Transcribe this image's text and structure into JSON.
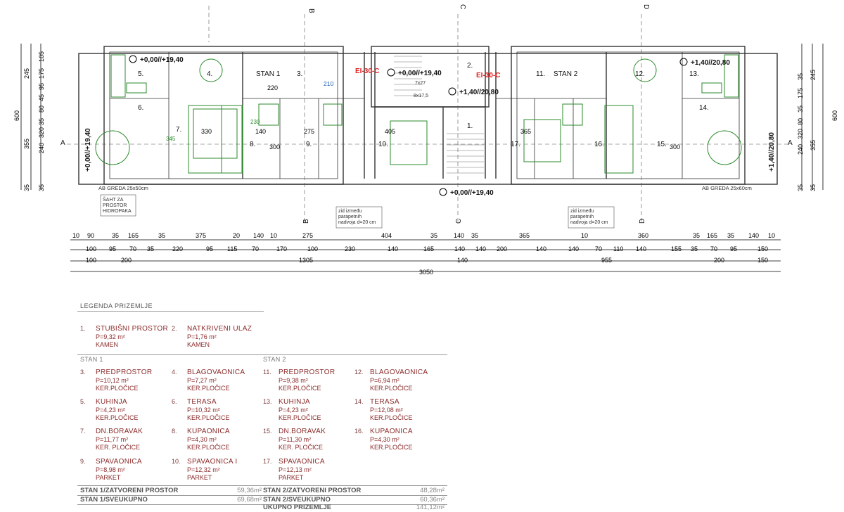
{
  "plan": {
    "dims_top_row1": [
      "10",
      "90",
      "35",
      "165",
      "35",
      "375",
      "20",
      "140",
      "10",
      "275",
      "404",
      "35",
      "140",
      "35",
      "365",
      "10",
      "360",
      "35",
      "165",
      "35",
      "140",
      "10"
    ],
    "dims_top_row2": [
      "100",
      "95",
      "70",
      "35",
      "220",
      "95",
      "115",
      "70",
      "170",
      "100",
      "230",
      "140",
      "165",
      "140",
      "140",
      "200",
      "140",
      "140",
      "70",
      "110",
      "140",
      "155",
      "35",
      "70",
      "95",
      "150"
    ],
    "dims_top_row3": [
      "100",
      "200",
      "1305",
      "140",
      "955",
      "200",
      "150"
    ],
    "dims_total": "3050",
    "dims_left": [
      "245",
      "105",
      "175",
      "95",
      "45",
      "80",
      "35",
      "355",
      "320",
      "240",
      "35",
      "35"
    ],
    "dims_left_total": "600",
    "dims_right": [
      "35",
      "175",
      "245",
      "35",
      "80",
      "320",
      "355",
      "240",
      "35",
      "35"
    ],
    "dims_right_total": "600",
    "section_marks": [
      "A",
      "A",
      "B",
      "B",
      "C",
      "C",
      "D",
      "D",
      "E"
    ],
    "elevations": [
      "+0,00//+19,40",
      "+0,00//+19,40",
      "+1,40//20,80",
      "+1,40//20,80",
      "+0,00//+19,40",
      "+0,00//+19,40",
      "+1,40//20,80"
    ],
    "room_numbers": [
      "1.",
      "2.",
      "3.",
      "4.",
      "5.",
      "6.",
      "7.",
      "8.",
      "9.",
      "10.",
      "11.",
      "12.",
      "13.",
      "14.",
      "15.",
      "16.",
      "17."
    ],
    "unit_labels": [
      "STAN 1",
      "STAN 2"
    ],
    "red_labels": [
      "EI-30-C",
      "EI-30-C"
    ],
    "beam_labels": [
      "AB GREDA 25x50cm",
      "AB GREDA 25x60cm"
    ],
    "shaft_note": [
      "ŠAHT ZA",
      "PROSTOR",
      "HIDROPAKA"
    ],
    "wall_note": [
      "zid između",
      "parapetnih",
      "nadvoja d=20 cm"
    ],
    "stair_note": [
      "7x27",
      "8x17,5"
    ],
    "inner_dims": [
      "330",
      "140",
      "275",
      "405",
      "365",
      "300",
      "300",
      "345",
      "220",
      "210",
      "230"
    ]
  },
  "legend": {
    "title": "LEGENDA PRIZEMLJE",
    "common": [
      {
        "num": "1.",
        "name": "STUBIŠNI PROSTOR",
        "area": "P=9,32 m²",
        "mat": "KAMEN"
      },
      {
        "num": "2.",
        "name": "NATKRIVENI ULAZ",
        "area": "P=1,76 m²",
        "mat": "KAMEN"
      }
    ],
    "stan1_label": "STAN 1",
    "stan2_label": "STAN 2",
    "stan1": [
      {
        "num": "3.",
        "name": "PREDPROSTOR",
        "area": "P=10,12 m²",
        "mat": "KER.PLOČICE"
      },
      {
        "num": "4.",
        "name": "BLAGOVAONICA",
        "area": "P=7,27 m²",
        "mat": "KER.PLOČICE"
      },
      {
        "num": "5.",
        "name": "KUHINJA",
        "area": "P=4,23 m²",
        "mat": "KER.PLOČICE"
      },
      {
        "num": "6.",
        "name": "TERASA",
        "area": "P=10,32 m²",
        "mat": "KER.PLOČICE"
      },
      {
        "num": "7.",
        "name": "DN.BORAVAK",
        "area": "P=11,77 m²",
        "mat": "KER. PLOČICE"
      },
      {
        "num": "8.",
        "name": "KUPAONICA",
        "area": "P=4,30 m²",
        "mat": "KER.PLOČICE"
      },
      {
        "num": "9.",
        "name": "SPAVAONICA",
        "area": "P=8,98 m²",
        "mat": "PARKET"
      },
      {
        "num": "10.",
        "name": "SPAVAONICA I",
        "area": "P=12,32 m²",
        "mat": "PARKET"
      }
    ],
    "stan2": [
      {
        "num": "11.",
        "name": "PREDPROSTOR",
        "area": "P=9,38 m²",
        "mat": "KER.PLOČICE"
      },
      {
        "num": "12.",
        "name": "BLAGOVAONICA",
        "area": "P=6,94 m²",
        "mat": "KER.PLOČICE"
      },
      {
        "num": "13.",
        "name": "KUHINJA",
        "area": "P=4,23 m²",
        "mat": "KER.PLOČICE"
      },
      {
        "num": "14.",
        "name": "TERASA",
        "area": "P=12,08 m²",
        "mat": "KER.PLOČICE"
      },
      {
        "num": "15.",
        "name": "DN.BORAVAK",
        "area": "P=11,30 m²",
        "mat": "KER. PLOČICE"
      },
      {
        "num": "16.",
        "name": "KUPAONICA",
        "area": "P=4,30 m²",
        "mat": "KER.PLOČICE"
      },
      {
        "num": "17.",
        "name": "SPAVAONICA",
        "area": "P=12,13 m²",
        "mat": "PARKET"
      }
    ],
    "summary": {
      "s1_closed_label": "STAN 1/ZATVORENI PROSTOR",
      "s1_closed_val": "59,36m²",
      "s1_total_label": "STAN 1/SVEUKUPNO",
      "s1_total_val": "69,68m²",
      "s2_closed_label": "STAN 2/ZATVORENI PROSTOR",
      "s2_closed_val": "48,28m²",
      "s2_total_label": "STAN 2/SVEUKUPNO",
      "s2_total_val": "60,36m²",
      "total_label": "UKUPNO PRIZEMLJE",
      "total_val": "141,12m²"
    }
  }
}
